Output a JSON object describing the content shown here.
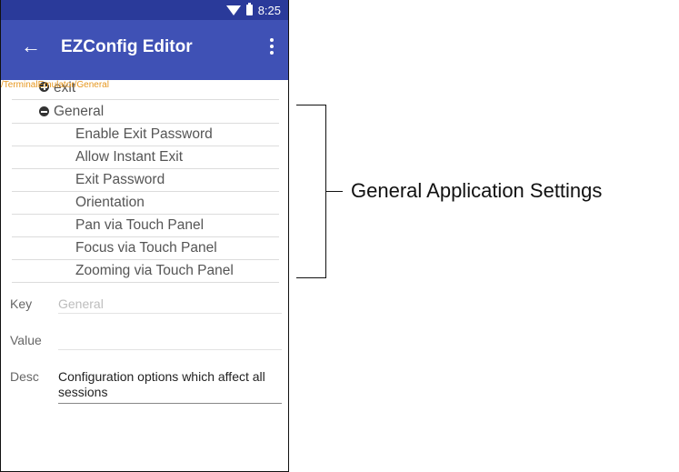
{
  "status_bar": {
    "time": "8:25"
  },
  "app_bar": {
    "title": "EZConfig Editor",
    "back_icon": "arrow-left-icon",
    "menu_icon": "overflow-menu-icon"
  },
  "path": "/TerminalEmulator/General",
  "tree": {
    "collapsed_item": "exit",
    "expanded_item": "General",
    "children": [
      "Enable Exit Password",
      "Allow Instant Exit",
      "Exit Password",
      "Orientation",
      "Pan via Touch Panel",
      "Focus via Touch Panel",
      "Zooming via Touch Panel"
    ]
  },
  "fields": {
    "key_label": "Key",
    "key_value": "General",
    "value_label": "Value",
    "value_value": "",
    "desc_label": "Desc",
    "desc_value": "Configuration options which affect all sessions"
  },
  "callout": {
    "label": "General Application Settings"
  },
  "colors": {
    "app_bar": "#3f51b5",
    "status_bar": "#2a3a9a",
    "path_text": "#e6961e"
  }
}
